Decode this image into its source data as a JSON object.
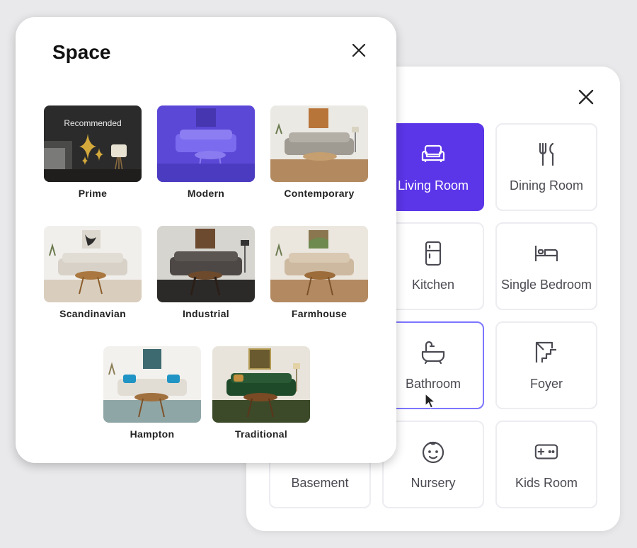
{
  "room_panel": {
    "rooms": [
      {
        "label": "Living Room",
        "icon": "sofa-icon",
        "state": "selected"
      },
      {
        "label": "Dining Room",
        "icon": "fork-knife-icon",
        "state": "default"
      },
      {
        "label": "Kitchen",
        "icon": "refrigerator-icon",
        "state": "default"
      },
      {
        "label": "Single Bedroom",
        "icon": "bed-icon",
        "state": "default"
      },
      {
        "label": "Bathroom",
        "icon": "bathtub-icon",
        "state": "hovered"
      },
      {
        "label": "Foyer",
        "icon": "stairs-icon",
        "state": "default"
      },
      {
        "label": "Basement",
        "icon": "basement-icon",
        "state": "default"
      },
      {
        "label": "Nursery",
        "icon": "baby-face-icon",
        "state": "default"
      },
      {
        "label": "Kids Room",
        "icon": "gamepad-icon",
        "state": "default"
      }
    ]
  },
  "space_panel": {
    "title": "Space",
    "styles": [
      {
        "label": "Prime",
        "badge": "Recommended"
      },
      {
        "label": "Modern"
      },
      {
        "label": "Contemporary"
      },
      {
        "label": "Scandinavian"
      },
      {
        "label": "Industrial"
      },
      {
        "label": "Farmhouse"
      },
      {
        "label": "Hampton"
      },
      {
        "label": "Traditional"
      }
    ]
  },
  "colors": {
    "accent": "#5b35e8",
    "hover_border": "#7d75ff",
    "text_dark": "#111111",
    "text_muted": "#4a4a52"
  }
}
